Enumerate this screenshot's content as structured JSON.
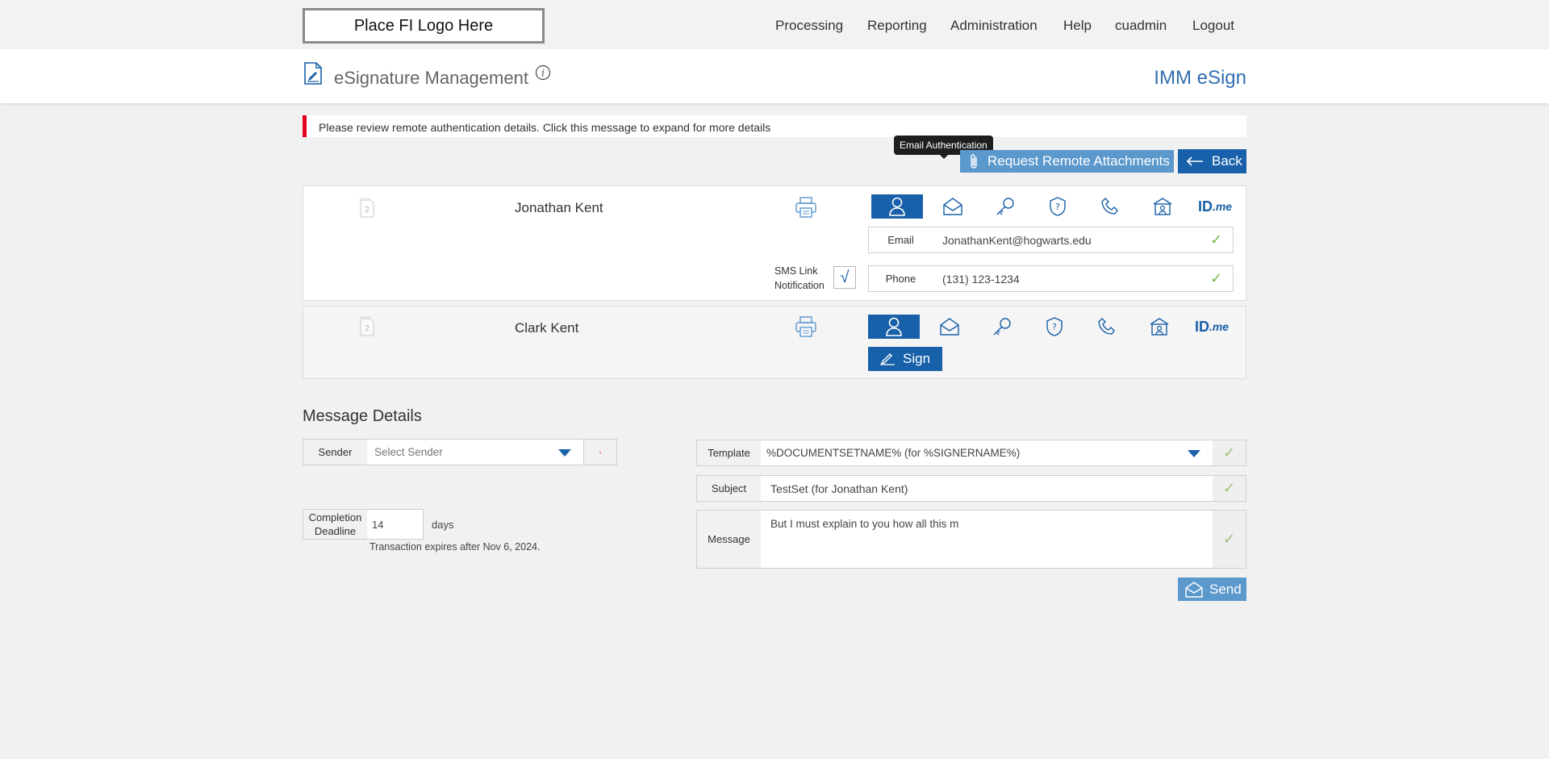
{
  "header": {
    "logo_text": "Place FI Logo Here",
    "nav": [
      "Processing",
      "Reporting",
      "Administration",
      "Help",
      "cuadmin",
      "Logout"
    ]
  },
  "title_band": {
    "page_title": "eSignature Management",
    "app_title": "IMM eSign"
  },
  "alert": {
    "text": "Please review remote authentication details. Click this message to expand for more details"
  },
  "tooltip": "Email Authentication",
  "actions": {
    "request_attachments_label": "Request Remote Attachments",
    "back_label": "Back"
  },
  "auth_icons": [
    "person-icon",
    "email-icon",
    "key-icon",
    "shield-question-icon",
    "phone-icon",
    "bank-user-icon",
    "idme-logo"
  ],
  "idme_text": "ID",
  "idme_suffix": ".me",
  "signers": [
    {
      "order": "2",
      "name": "Jonathan Kent",
      "email_label": "Email",
      "email": "JonathanKent@hogwarts.edu",
      "phone_label": "Phone",
      "phone": "(131) 123-1234",
      "sms_label": "SMS Link Notification",
      "sms_line1": "SMS Link",
      "sms_line2": "Notification"
    },
    {
      "order": "2",
      "name": "Clark Kent",
      "sign_label": "Sign"
    }
  ],
  "message_details": {
    "title": "Message Details",
    "sender_label": "Sender",
    "sender_placeholder": "Select Sender",
    "required_marker": "·",
    "completion_label_1": "Completion",
    "completion_label_2": "Deadline",
    "deadline_value": "14",
    "days_label": "days",
    "expiry_text": "Transaction expires after Nov 6, 2024.",
    "template_label": "Template",
    "template_value": "%DOCUMENTSETNAME% (for %SIGNERNAME%)",
    "subject_label": "Subject",
    "subject_value": "TestSet (for Jonathan Kent)",
    "message_label": "Message",
    "message_value": "But I must explain to you how all this m",
    "send_label": "Send"
  },
  "colors": {
    "brand_blue": "#1860a9",
    "light_blue": "#5b98cc",
    "alert_red": "#e3001b",
    "check_green": "#7ab648"
  }
}
